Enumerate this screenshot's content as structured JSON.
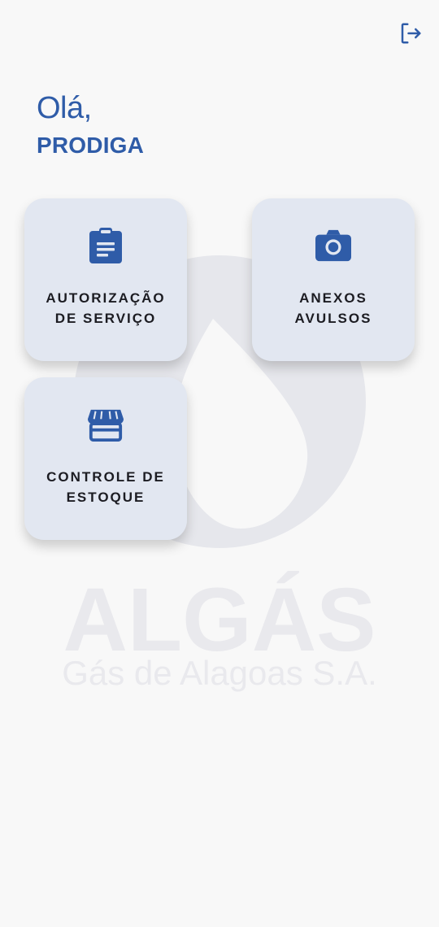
{
  "header": {
    "greeting": "Olá,",
    "username": "PRODIGA"
  },
  "menu": {
    "cards": [
      {
        "line1": "AUTORIZAÇÃO",
        "line2": "DE SERVIÇO",
        "icon": "clipboard-icon"
      },
      {
        "line1": "ANEXOS",
        "line2": "AVULSOS",
        "icon": "camera-icon"
      },
      {
        "line1": "CONTROLE DE",
        "line2": "ESTOQUE",
        "icon": "store-icon"
      }
    ]
  },
  "watermark": {
    "brand": "ALGÁS",
    "tagline": "Gás de Alagoas S.A."
  },
  "colors": {
    "accent": "#2f5ca8",
    "card_bg": "#e2e7f1",
    "text_dark": "#1c1c22",
    "background": "#f8f8f8",
    "watermark": "#e9e9ed"
  }
}
